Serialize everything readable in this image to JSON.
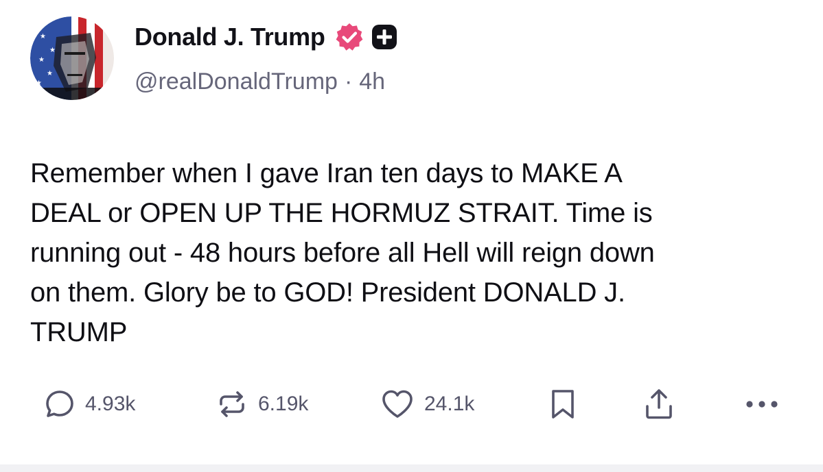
{
  "author": {
    "display_name": "Donald J. Trump",
    "handle": "@realDonaldTrump",
    "separator": "·",
    "time_ago": "4h",
    "avatar_icon": "flag-portrait-avatar",
    "verified_icon": "verified-badge-icon",
    "verified_color": "#e8497a",
    "plus_icon": "plus-badge-icon"
  },
  "post": {
    "lines": [
      "Remember when I gave Iran ten days to MAKE A",
      "DEAL or OPEN UP THE HORMUZ STRAIT. Time is",
      "running out - 48 hours before all Hell will reign down",
      "on them. Glory be to GOD! President DONALD J.",
      "TRUMP"
    ]
  },
  "actions": {
    "reply": {
      "icon": "reply-icon",
      "count": "4.93k"
    },
    "repost": {
      "icon": "repost-icon",
      "count": "6.19k"
    },
    "like": {
      "icon": "heart-icon",
      "count": "24.1k"
    },
    "bookmark": {
      "icon": "bookmark-icon"
    },
    "share": {
      "icon": "share-icon"
    },
    "more": {
      "icon": "more-icon"
    }
  },
  "colors": {
    "text": "#0f0f14",
    "muted": "#66667a",
    "icon": "#55556a",
    "accent": "#e8497a"
  }
}
